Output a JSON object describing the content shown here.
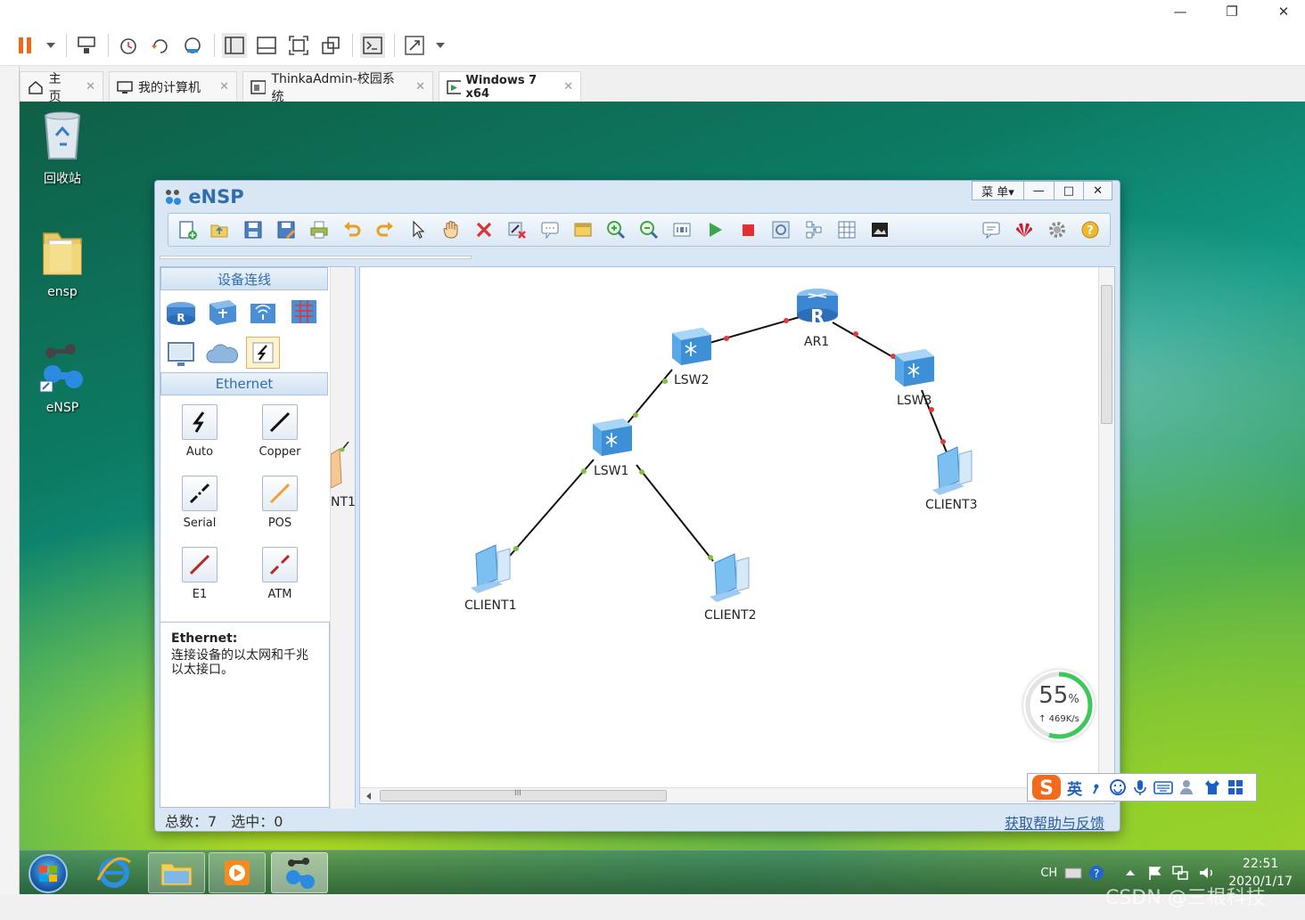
{
  "host": {
    "window_controls": {
      "minimize": "—",
      "restore": "❐",
      "close": "✕"
    },
    "tabs": [
      {
        "label": "主页"
      },
      {
        "label": "我的计算机"
      },
      {
        "label": "ThinkaAdmin-校园系统"
      },
      {
        "label": "Windows 7 x64"
      }
    ],
    "tab_close": "✕"
  },
  "desktop": {
    "icons": [
      {
        "label": "回收站"
      },
      {
        "label": "ensp"
      },
      {
        "label": "eNSP"
      }
    ]
  },
  "ensp": {
    "title": "eNSP",
    "menu_label": "菜 单▾",
    "win_min": "—",
    "win_max": "□",
    "win_close": "✕",
    "panel_title": "设备连线",
    "category_title": "Ethernet",
    "links": [
      {
        "label": "Auto"
      },
      {
        "label": "Copper"
      },
      {
        "label": "Serial"
      },
      {
        "label": "POS"
      },
      {
        "label": "E1"
      },
      {
        "label": "ATM"
      }
    ],
    "desc_title": "Ethernet:",
    "desc_text": "连接设备的以太网和千兆以太接口。",
    "nodes": {
      "ar1": "AR1",
      "lsw1": "LSW1",
      "lsw2": "LSW2",
      "lsw3": "LSW3",
      "client1": "CLIENT1",
      "client2": "CLIENT2",
      "client3": "CLIENT3",
      "partial": "NT1"
    },
    "hscroll_grip": "III",
    "status_total": "总数：7",
    "status_selected": "选中：0",
    "help_link": "获取帮助与反馈"
  },
  "speed_widget": {
    "percent": "55",
    "unit": "%",
    "rate": "↑ 469K/s",
    "percent_value": 55
  },
  "ime": {
    "mode": "英"
  },
  "tray": {
    "lang": "CH",
    "time": "22:51",
    "date": "2020/1/17"
  },
  "watermark": "CSDN @三根科技",
  "colors": {
    "accent": "#2f6db0",
    "link_ok": "#7dc241",
    "link_down": "#e03c3c"
  }
}
